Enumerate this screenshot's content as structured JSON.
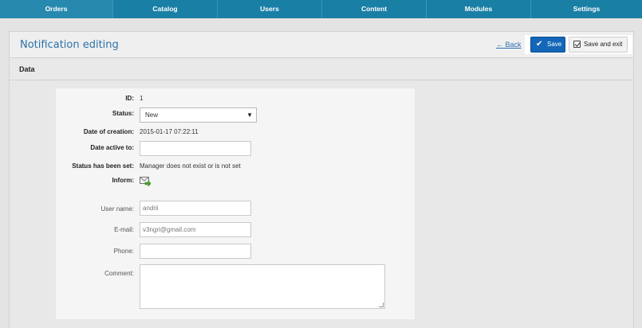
{
  "nav": {
    "items": [
      "Orders",
      "Catalog",
      "Users",
      "Content",
      "Modules",
      "Settings"
    ]
  },
  "header": {
    "title": "Notification editing",
    "back_label": "← Back",
    "save_label": "Save",
    "save_exit_label": "Save and exit"
  },
  "section": {
    "title": "Data"
  },
  "form": {
    "id_label": "ID:",
    "id_value": "1",
    "status_label": "Status:",
    "status_value": "New",
    "created_label": "Date of creation:",
    "created_value": "2015-01-17 07:22:11",
    "active_to_label": "Date active to:",
    "active_to_value": "",
    "set_by_label": "Status has been set:",
    "set_by_value": "Manager does not exist or is not set",
    "inform_label": "Inform:",
    "username_label": "User name:",
    "username_value": "andrii",
    "email_label": "E-mail:",
    "email_value": "v3ngri@gmail.com",
    "phone_label": "Phone:",
    "phone_value": "",
    "comment_label": "Comment:",
    "comment_value": ""
  },
  "colors": {
    "nav_bg": "#1a7fa5",
    "title": "#2b72a8",
    "save_button": "#1366b8"
  },
  "icons": {
    "inform": "mail-send-icon",
    "save": "checkmark-icon",
    "save_exit": "checkbox-icon",
    "select": "chevron-down-icon"
  }
}
